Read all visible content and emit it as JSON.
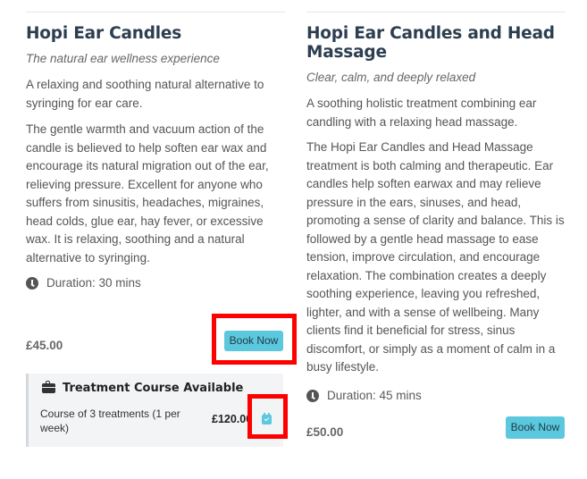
{
  "left_card": {
    "title": "Hopi Ear Candles",
    "tagline": "The natural ear wellness experience",
    "summary": "A relaxing and soothing natural alternative to syringing for ear care.",
    "description": "The gentle warmth and vacuum action of the candle is believed to help soften ear wax and encourage its natural migration out of the ear, relieving pressure. Excellent for anyone who suffers from sinusitis, headaches, migraines, head colds, glue ear, hay fever, or excessive wax. It is relaxing, soothing and a natural alternative to syringing.",
    "duration": "Duration: 30 mins",
    "price": "£45.00",
    "book_label": "Book Now",
    "course": {
      "title": "Treatment Course Available",
      "description": "Course of 3 treatments (1 per week)",
      "price": "£120.00"
    }
  },
  "right_card": {
    "title": "Hopi Ear Candles and Head Massage",
    "tagline": "Clear, calm, and deeply relaxed",
    "summary": "A soothing holistic treatment combining ear candling with a relaxing head massage.",
    "description": "The Hopi Ear Candles and Head Massage treatment is both calming and therapeutic. Ear candles help soften earwax and may relieve pressure in the ears, sinuses, and head, promoting a sense of clarity and balance. This is followed by a gentle head massage to ease tension, improve circulation, and encourage relaxation. The combination creates a deeply soothing experience, leaving you refreshed, lighter, and with a sense of wellbeing. Many clients find it beneficial for stress, sinus discomfort, or simply as a moment of calm in a busy lifestyle.",
    "duration": "Duration: 45 mins",
    "price": "£50.00",
    "book_label": "Book Now"
  },
  "colors": {
    "accent": "#5bc8dd",
    "heading": "#2c3e50",
    "highlight": "#ff0000"
  },
  "icons": [
    "clock-icon",
    "briefcase-icon",
    "calendar-check-icon"
  ]
}
